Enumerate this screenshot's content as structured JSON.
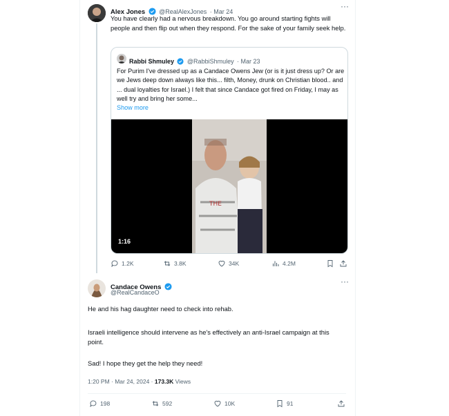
{
  "alex": {
    "name": "Alex Jones",
    "handle": "@RealAlexJones",
    "time": "· Mar 24",
    "text": "You have clearly had a nervous breakdown. You go around starting fights will people and then flip out when they respond. For the sake of your family seek help."
  },
  "quote": {
    "name": "Rabbi Shmuley",
    "handle": "@RabbiShmuley",
    "time": "· Mar 23",
    "text": "For Purim I've dressed up as a Candace Owens Jew (or is it just dress up? Or are we Jews deep down always like this... filth, Money, drunk on Christian blood.. and ... dual loyalties for Israel.) I felt that since Candace got fired on Friday, I may as well try and bring her some...",
    "show_more": "Show more",
    "video_time": "1:16"
  },
  "alex_actions": {
    "replies": "1.2K",
    "reposts": "3.8K",
    "likes": "34K",
    "views": "4.2M"
  },
  "candace": {
    "name": "Candace Owens",
    "handle": "@RealCandaceO",
    "p1": "He and his hag daughter need to check into rehab.",
    "p2": "Israeli intelligence should intervene as he's effectively an anti-Israel campaign at this point.",
    "p3": "Sad! I hope they get the help they need!",
    "time": "1:20 PM · Mar 24, 2024 · ",
    "views": "173.3K",
    "views_label": " Views"
  },
  "candace_actions": {
    "replies": "198",
    "reposts": "592",
    "likes": "10K",
    "bookmarks": "91"
  },
  "colors": {
    "verified": "#1d9bf0",
    "muted": "#536471",
    "link": "#1d9bf0"
  }
}
